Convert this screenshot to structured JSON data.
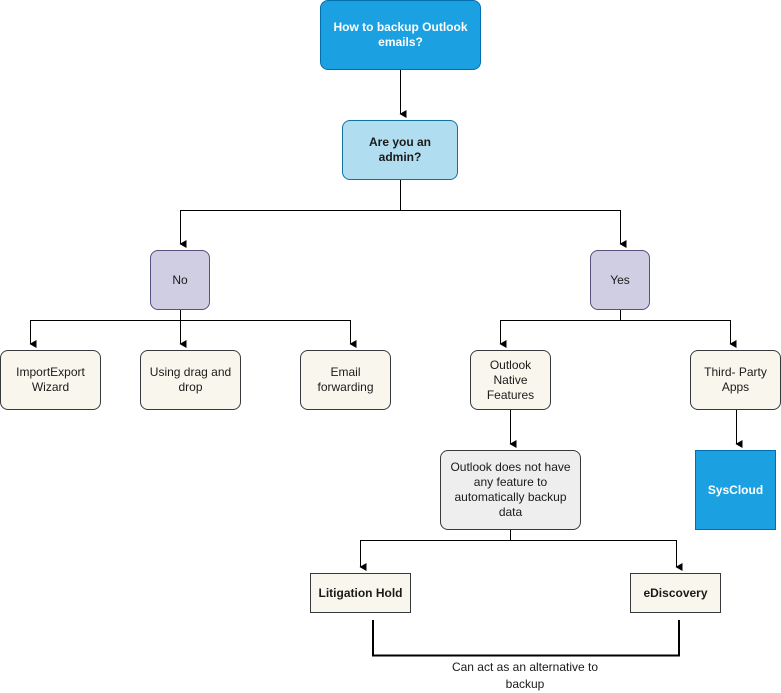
{
  "diagram": {
    "title": "How to backup Outlook emails?",
    "question": "Are you an admin?",
    "answers": {
      "no": "No",
      "yes": "Yes"
    },
    "no_options": [
      "ImportExport Wizard",
      "Using drag and drop",
      "Email forwarding"
    ],
    "yes_options": {
      "native": "Outlook Native Features",
      "third_party": "Third- Party Apps"
    },
    "native_note": "Outlook does not have any feature to automatically backup data",
    "alternatives": [
      "Litigation Hold",
      "eDiscovery"
    ],
    "alternatives_label": "Can act as an alternative to backup",
    "third_party_product": "SysCloud"
  },
  "colors": {
    "root_fill": "#1ba1e2",
    "question_fill": "#b1ddf0",
    "answer_fill": "#d0cee2",
    "option_fill": "#f9f7ed",
    "note_fill": "#eeeeee",
    "brand_fill": "#1ba1e2"
  }
}
